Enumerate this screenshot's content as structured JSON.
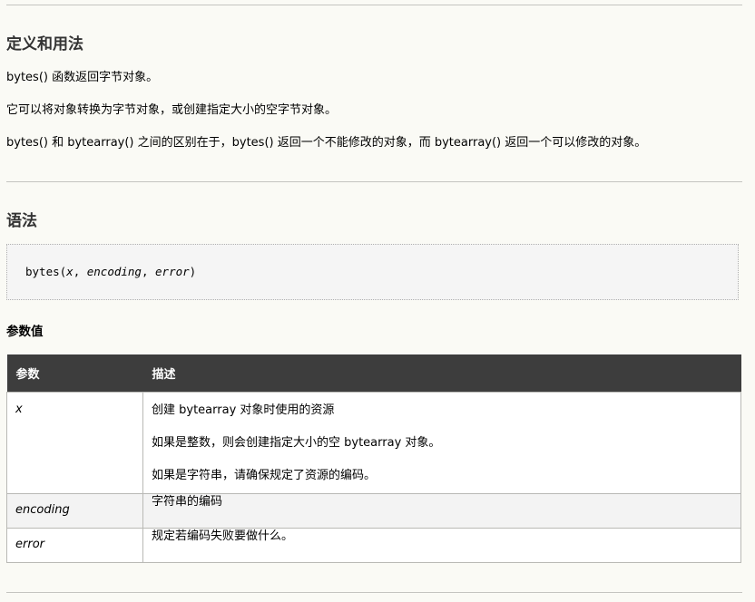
{
  "section1": {
    "title": "定义和用法",
    "paragraphs": [
      "bytes() 函数返回字节对象。",
      "它可以将对象转换为字节对象，或创建指定大小的空字节对象。",
      "bytes() 和 bytearray() 之间的区别在于，bytes() 返回一个不能修改的对象，而 bytearray() 返回一个可以修改的对象。"
    ]
  },
  "section2": {
    "title": "语法",
    "code": {
      "func": "bytes(",
      "arg1": "x",
      "sep1": ", ",
      "arg2": "encoding",
      "sep2": ", ",
      "arg3": "error",
      "close": ")"
    }
  },
  "params": {
    "title": "参数值",
    "headers": [
      "参数",
      "描述"
    ],
    "rows": [
      {
        "name": "x",
        "desc": [
          "创建 bytearray 对象时使用的资源",
          "如果是整数，则会创建指定大小的空 bytearray 对象。",
          "如果是字符串，请确保规定了资源的编码。"
        ]
      },
      {
        "name": "encoding",
        "desc": [
          "字符串的编码"
        ]
      },
      {
        "name": "error",
        "desc": [
          "规定若编码失败要做什么。"
        ]
      }
    ]
  }
}
